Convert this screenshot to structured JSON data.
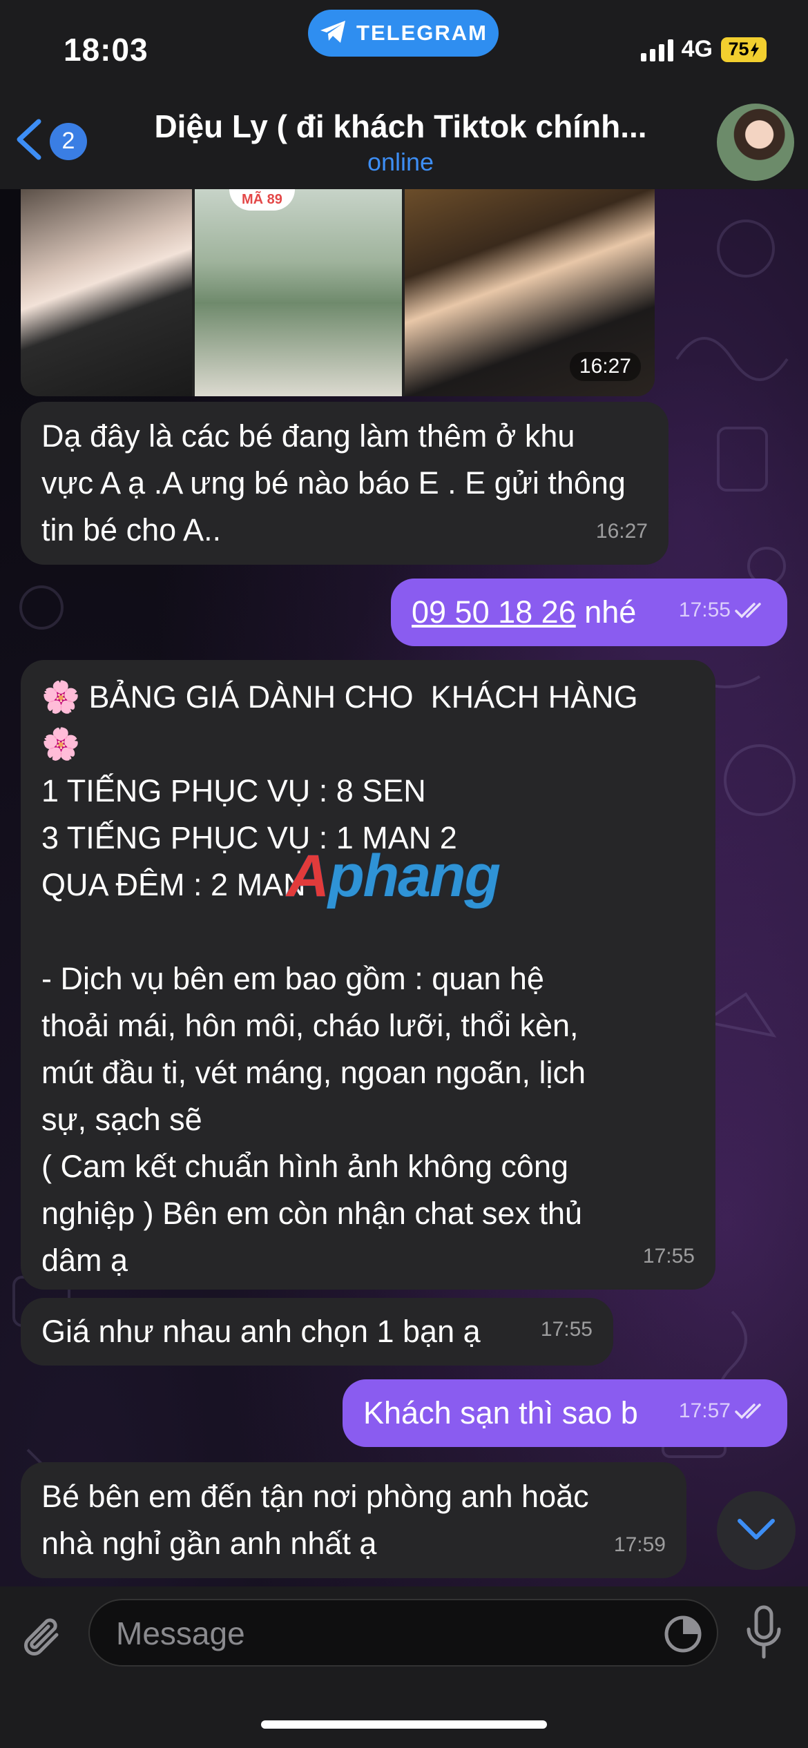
{
  "status_bar": {
    "time": "18:03",
    "app_pill": "TELEGRAM",
    "network": "4G",
    "battery": "75"
  },
  "header": {
    "back_count": "2",
    "title": "Diệu Ly ( đi khách Tiktok chính...",
    "status": "online"
  },
  "photos": {
    "tag": "MÃ 89",
    "time": "16:27"
  },
  "messages": [
    {
      "side": "in",
      "text": "Dạ đây là các bé đang làm thêm ở khu\nvực A ạ .A ưng bé nào báo E . E gửi thông\ntin bé cho A..",
      "time": "16:27"
    },
    {
      "side": "out",
      "link": "09 50 18 26",
      "text": " nhé",
      "time": "17:55"
    },
    {
      "side": "in",
      "text": "🌸 BẢNG GIÁ DÀNH CHO  KHÁCH HÀNG\n🌸\n1 TIẾNG PHỤC VỤ : 8 SEN\n3 TIẾNG PHỤC VỤ : 1 MAN 2\nQUA ĐÊM : 2 MAN\n\n- Dịch vụ bên em bao gồm : quan hệ\nthoải mái, hôn môi, cháo lưỡi, thổi kèn,\nmút đầu ti, vét máng, ngoan ngoãn, lịch\nsự, sạch sẽ\n( Cam kết chuẩn hình ảnh không công\nnghiệp ) Bên em còn nhận chat sex thủ\ndâm ạ",
      "time": "17:55"
    },
    {
      "side": "in",
      "text": "Giá như nhau anh chọn 1 bạn ạ",
      "time": "17:55"
    },
    {
      "side": "out",
      "text": "Khách sạn thì sao b",
      "time": "17:57"
    },
    {
      "side": "in",
      "text": "Bé bên em đến tận nơi phòng anh hoăc\nnhà nghỉ gần anh nhất ạ",
      "time": "17:59"
    }
  ],
  "watermark": {
    "a": "A",
    "rest": "phang"
  },
  "input": {
    "placeholder": "Message"
  },
  "colors": {
    "outgoing_bubble": "#8a5cf0",
    "incoming_bubble": "#262628",
    "accent": "#3d8ef5"
  },
  "icons": [
    "telegram-icon",
    "back-chevron-icon",
    "attach-paperclip-icon",
    "sticker-icon",
    "microphone-icon",
    "chevron-down-icon",
    "read-checks-icon"
  ]
}
